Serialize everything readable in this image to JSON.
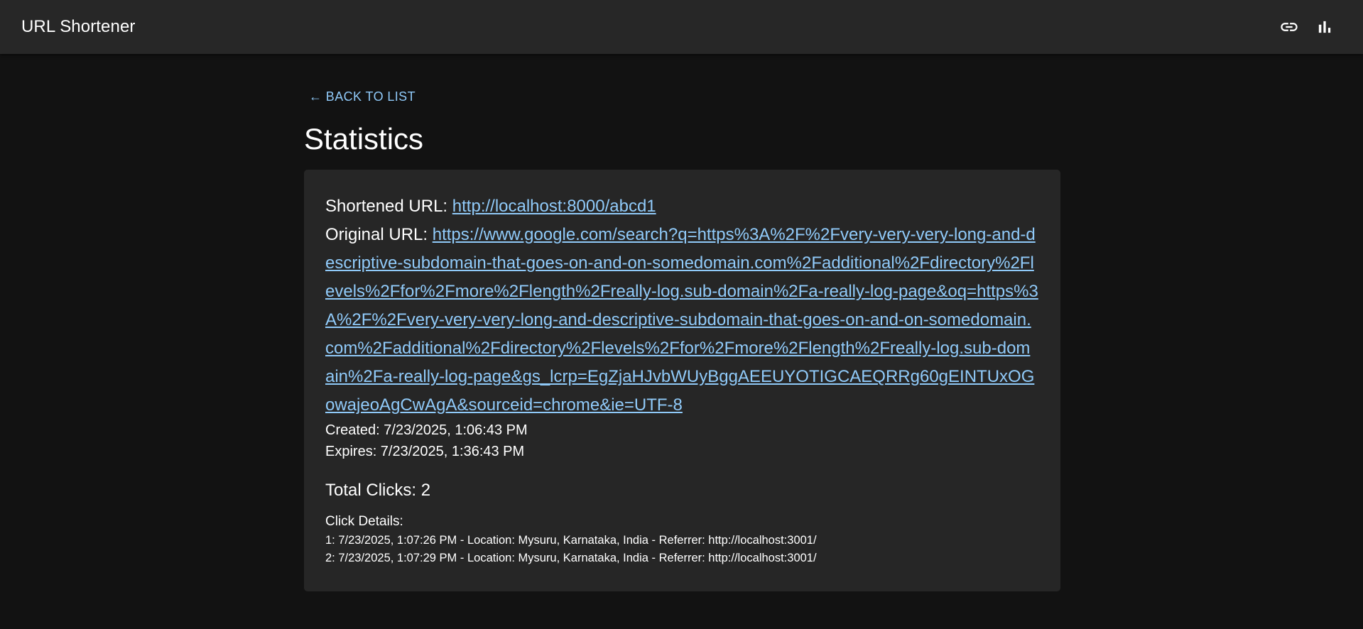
{
  "appbar": {
    "title": "URL Shortener",
    "icons": [
      "link-icon",
      "bar-chart-icon"
    ]
  },
  "page": {
    "back_label": "← BACK TO LIST",
    "title": "Statistics"
  },
  "details": {
    "shortened_label": "Shortened URL: ",
    "shortened_url": "http://localhost:8000/abcd1",
    "original_label": "Original URL: ",
    "original_url": "https://www.google.com/search?q=https%3A%2F%2Fvery-very-very-long-and-descriptive-subdomain-that-goes-on-and-on-somedomain.com%2Fadditional%2Fdirectory%2Flevels%2Ffor%2Fmore%2Flength%2Freally-log.sub-domain%2Fa-really-log-page&oq=https%3A%2F%2Fvery-very-very-long-and-descriptive-subdomain-that-goes-on-and-on-somedomain.com%2Fadditional%2Fdirectory%2Flevels%2Ffor%2Fmore%2Flength%2Freally-log.sub-domain%2Fa-really-log-page&gs_lcrp=EgZjaHJvbWUyBggAEEUYOTIGCAEQRRg60gEINTUxOGowajeoAgCwAgA&sourceid=chrome&ie=UTF-8",
    "created": "Created: 7/23/2025, 1:06:43 PM",
    "expires": "Expires: 7/23/2025, 1:36:43 PM",
    "total_clicks": "Total Clicks: 2",
    "click_details_label": "Click Details:",
    "clicks": [
      "1: 7/23/2025, 1:07:26 PM - Location: Mysuru, Karnataka, India - Referrer: http://localhost:3001/",
      "2: 7/23/2025, 1:07:29 PM - Location: Mysuru, Karnataka, India - Referrer: http://localhost:3001/"
    ]
  },
  "colors": {
    "background": "#121212",
    "appbar": "#272727",
    "card": "#262626",
    "link": "#90caf9",
    "text": "#ffffff"
  }
}
